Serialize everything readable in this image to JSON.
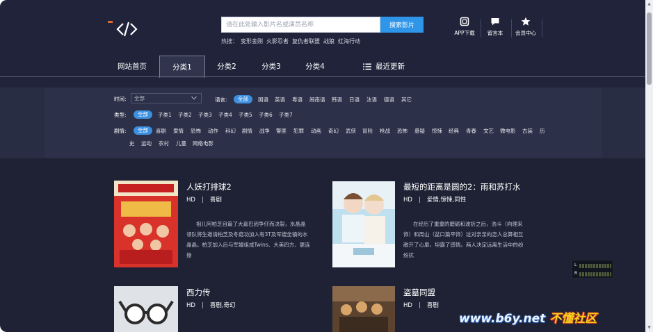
{
  "header": {
    "search": {
      "placeholder": "请在此处输入影片名或演员名称",
      "button_label": "搜索影片"
    },
    "hot_search": {
      "label": "热搜：",
      "terms": [
        "变形金刚",
        "火影忍者",
        "复仇者联盟",
        "战狼",
        "红海行动"
      ]
    },
    "tools": [
      {
        "label": "APP下载",
        "icon": "app-icon"
      },
      {
        "label": "留言本",
        "icon": "message-icon"
      },
      {
        "label": "会员中心",
        "icon": "star-icon"
      }
    ]
  },
  "nav": {
    "items": [
      "网站首页",
      "分类1",
      "分类2",
      "分类3",
      "分类4"
    ],
    "active_index": 1,
    "recent_label": "最近更新"
  },
  "filters": {
    "time": {
      "label": "时间:",
      "selected": "全部"
    },
    "language": {
      "label": "语言:",
      "active": "全部",
      "options": [
        "国语",
        "英语",
        "粤语",
        "闽南语",
        "韩语",
        "日语",
        "法语",
        "德语",
        "其它"
      ]
    },
    "type": {
      "label": "类型:",
      "active": "全部",
      "options": [
        "子类1",
        "子类2",
        "子类3",
        "子类4",
        "子类5",
        "子类6",
        "子类7"
      ]
    },
    "genre": {
      "label": "剧情:",
      "active": "全部",
      "options_row1": [
        "喜剧",
        "爱情",
        "恐怖",
        "动作",
        "科幻",
        "剧情",
        "战争",
        "警匪",
        "犯罪",
        "动画",
        "奇幻",
        "武侠",
        "冒险",
        "枪战",
        "恐怖",
        "悬疑",
        "惊悚",
        "经典",
        "青春",
        "文艺",
        "微电影",
        "古装",
        "历"
      ],
      "options_row2": [
        "史",
        "运动",
        "农村",
        "儿童",
        "网络电影"
      ]
    }
  },
  "movies": [
    {
      "title": "人妖打排球2",
      "quality": "HD",
      "genre": "喜剧",
      "description": "祖儿阿柏芝自篇了大嘉巴因争仔而决裂，水晶晶领队将生邀请柏芝及冬菇功加入有3T及军嫂坐镇的水晶晶。柏芝加入后与军嫂组成Twins、大美四方、更连接",
      "colors": {
        "primary": "#d8322a",
        "secondary": "#f2e4c6"
      }
    },
    {
      "title": "最短的距离是圆的2：雨和苏打水",
      "quality": "HD",
      "genre": "爱情,惊悚,同性",
      "description": "在经历了重重的磨砺和波折之后，浩斗（向理来饰）和周山（盆口篇平饰）这对亲亲的恋人总算相互敞开了心扉，坦露了感情。两人决定远离生活中的纷纷扰",
      "colors": {
        "primary": "#bfe0ef",
        "secondary": "#f4f7f9"
      }
    },
    {
      "title": "西力传",
      "quality": "HD",
      "genre": "喜剧,奇幻",
      "description": "",
      "colors": {
        "primary": "#dfe3e8",
        "secondary": "#2b2b2b"
      }
    },
    {
      "title": "盗墓同盟",
      "quality": "HD",
      "genre": "喜剧",
      "description": "",
      "colors": {
        "primary": "#5b4330",
        "secondary": "#d7a56a"
      }
    }
  ],
  "widget": {
    "left_label": "L",
    "right_label": "R"
  },
  "watermark": {
    "site": "www.b6y.net",
    "brand": "不懂社区"
  },
  "theme": {
    "background": "#1f2235",
    "accent": "#2e95e8",
    "chip": "#3d8fe0"
  }
}
